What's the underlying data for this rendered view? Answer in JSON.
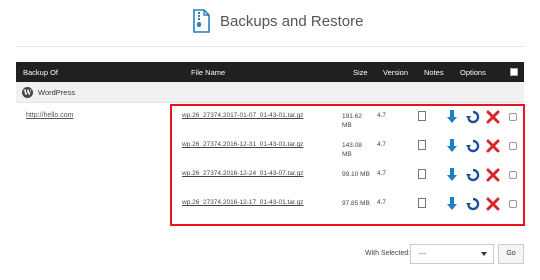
{
  "header": {
    "title": "Backups and Restore",
    "icon": "backup-file-icon"
  },
  "table": {
    "columns": {
      "backup_of": "Backup Of",
      "file_name": "File Name",
      "size": "Size",
      "version": "Version",
      "notes": "Notes",
      "options": "Options"
    },
    "group": {
      "label": "WordPress",
      "icon": "wordpress-icon"
    },
    "site": "http://hello.com",
    "rows": [
      {
        "file": "wp.26_27374.2017-01-07_01-43-01.tar.gz",
        "size": "191.62 MB",
        "version": "4.7"
      },
      {
        "file": "wp.26_27374.2016-12-31_01-43-01.tar.gz",
        "size": "143.08 MB",
        "version": "4.7"
      },
      {
        "file": "wp.26_27374.2016-12-24_01-43-07.tar.gz",
        "size": "99.10 MB",
        "version": "4.7"
      },
      {
        "file": "wp.26_27374.2016-12-17_01-43-01.tar.gz",
        "size": "97.85 MB",
        "version": "4.7"
      }
    ]
  },
  "footer": {
    "with_selected_label": "With Selected:",
    "selected_value": "---",
    "go_label": "Go"
  },
  "colors": {
    "header_bg": "#202020",
    "highlight": "#e8141f",
    "download": "#1d7fc4",
    "restore": "#1c4f9c",
    "delete": "#d9262c"
  }
}
